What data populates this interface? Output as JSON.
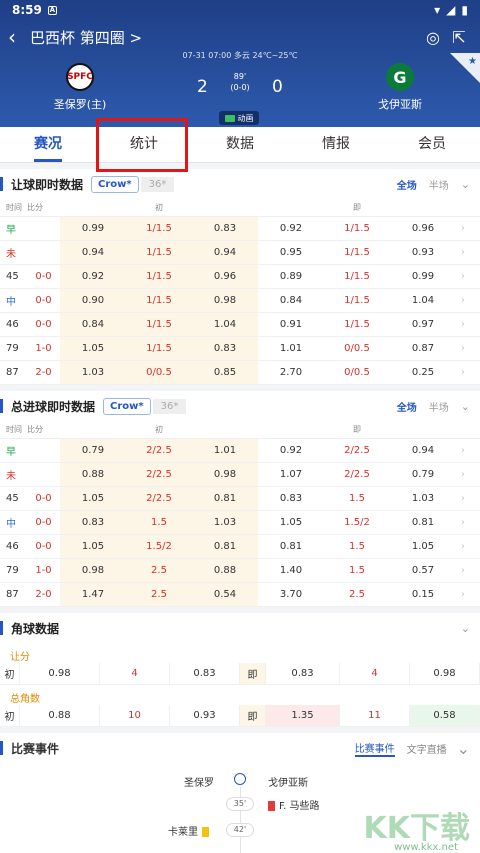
{
  "status": {
    "time": "8:59",
    "a": "A"
  },
  "nav": {
    "title": "巴西杯 第四圈 >"
  },
  "match": {
    "meta": "07-31 07:00 多云 24℃~25℃",
    "home": "圣保罗(主)",
    "away": "戈伊亚斯",
    "home_score": "2",
    "away_score": "0",
    "minute": "89'",
    "half": "(0-0)",
    "anim": "动画",
    "home_logo": "SPFC",
    "away_logo": "G"
  },
  "tabs": [
    "赛况",
    "统计",
    "数据",
    "情报",
    "会员"
  ],
  "s1": {
    "title": "让球即时数据",
    "chip": "Crow*",
    "chip2": "36*",
    "full": "全场",
    "half": "半场"
  },
  "cols": {
    "time": "时间",
    "score": "比分",
    "first": "初",
    "now": "即"
  },
  "r1": [
    [
      "早",
      "",
      "0.99",
      "1/1.5",
      "0.83",
      "0.92",
      "1/1.5",
      "0.96"
    ],
    [
      "未",
      "",
      "0.94",
      "1/1.5",
      "0.94",
      "0.95",
      "1/1.5",
      "0.93"
    ],
    [
      "45",
      "0-0",
      "0.92",
      "1/1.5",
      "0.96",
      "0.89",
      "1/1.5",
      "0.99"
    ],
    [
      "中",
      "0-0",
      "0.90",
      "1/1.5",
      "0.98",
      "0.84",
      "1/1.5",
      "1.04"
    ],
    [
      "46",
      "0-0",
      "0.84",
      "1/1.5",
      "1.04",
      "0.91",
      "1/1.5",
      "0.97"
    ],
    [
      "79",
      "1-0",
      "1.05",
      "1/1.5",
      "0.83",
      "1.01",
      "0/0.5",
      "0.87"
    ],
    [
      "87",
      "2-0",
      "1.03",
      "0/0.5",
      "0.85",
      "2.70",
      "0/0.5",
      "0.25"
    ]
  ],
  "s2": {
    "title": "总进球即时数据",
    "chip": "Crow*",
    "chip2": "36*",
    "full": "全场",
    "half": "半场"
  },
  "r2": [
    [
      "早",
      "",
      "0.79",
      "2/2.5",
      "1.01",
      "0.92",
      "2/2.5",
      "0.94"
    ],
    [
      "未",
      "",
      "0.88",
      "2/2.5",
      "0.98",
      "1.07",
      "2/2.5",
      "0.79"
    ],
    [
      "45",
      "0-0",
      "1.05",
      "2/2.5",
      "0.81",
      "0.83",
      "1.5",
      "1.03"
    ],
    [
      "中",
      "0-0",
      "0.83",
      "1.5",
      "1.03",
      "1.05",
      "1.5/2",
      "0.81"
    ],
    [
      "46",
      "0-0",
      "1.05",
      "1.5/2",
      "0.81",
      "0.81",
      "1.5",
      "1.05"
    ],
    [
      "79",
      "1-0",
      "0.98",
      "2.5",
      "0.88",
      "1.40",
      "1.5",
      "0.57"
    ],
    [
      "87",
      "2-0",
      "1.47",
      "2.5",
      "0.54",
      "3.70",
      "2.5",
      "0.15"
    ]
  ],
  "corner": {
    "title": "角球数据",
    "sub1": "让分",
    "sub2": "总角数",
    "r1": [
      "初",
      "0.98",
      "4",
      "0.83",
      "即",
      "0.83",
      "4",
      "0.98"
    ],
    "r2": [
      "初",
      "0.88",
      "10",
      "0.93",
      "即",
      "1.35",
      "11",
      "0.58"
    ]
  },
  "events": {
    "title": "比赛事件",
    "tab1": "比赛事件",
    "tab2": "文字直播",
    "home": "圣保罗",
    "away": "戈伊亚斯",
    "m1": "35'",
    "p1": "F. 马些路",
    "m2": "42'",
    "p2": "卡莱里"
  },
  "watermark": {
    "big": "KK下载",
    "small": "www.kkx.net"
  }
}
